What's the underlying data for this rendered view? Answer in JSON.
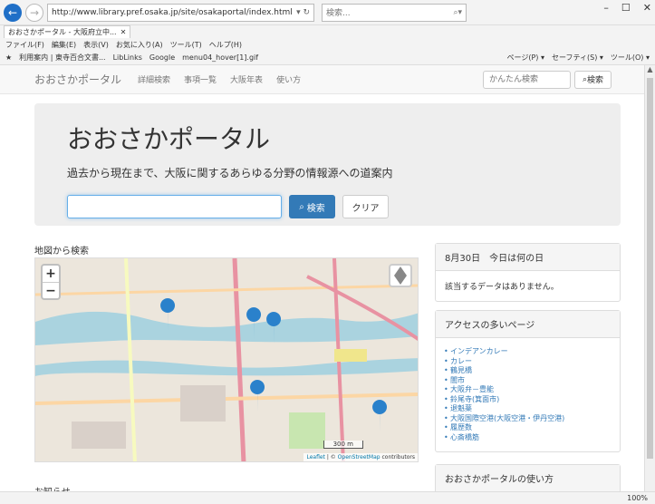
{
  "browser": {
    "url_host": "http://www.library.pref.osaka.jp",
    "url_path": "/site/osakaportal/index.html",
    "search_placeholder": "検索...",
    "tab_title": "おおさかポータル - 大阪府立中...",
    "menu": [
      "ファイル(F)",
      "編集(E)",
      "表示(V)",
      "お気に入り(A)",
      "ツール(T)",
      "ヘルプ(H)"
    ],
    "favorites": [
      "利用案内 | 東寺百合文書...",
      "LibLinks",
      "Google",
      "menu04_hover[1].gif"
    ],
    "toolbar_right": [
      "ページ(P) ▾",
      "セーフティ(S) ▾",
      "ツール(O) ▾"
    ],
    "zoom": "100%"
  },
  "site": {
    "brand": "おおさかポータル",
    "nav": [
      "詳細検索",
      "事項一覧",
      "大阪年表",
      "使い方"
    ],
    "search_placeholder": "かんたん検索",
    "search_button": "検索"
  },
  "hero": {
    "title": "おおさかポータル",
    "subtitle": "過去から現在まで、大阪に関するあらゆる分野の情報源への道案内",
    "search_button": "検索",
    "clear_button": "クリア"
  },
  "map": {
    "title": "地図から検索",
    "zoom_in": "+",
    "zoom_out": "−",
    "scale": "300 m",
    "attribution_leaflet": "Leaflet",
    "attribution_osm": "OpenStreetMap",
    "attribution_suffix": "contributors"
  },
  "today": {
    "header": "8月30日　今日は何の日",
    "body": "該当するデータはありません。"
  },
  "popular": {
    "header": "アクセスの多いページ",
    "items": [
      "インデアンカレー",
      "カレー",
      "鶴見橋",
      "闇市",
      "大阪弁－豊能",
      "鈴尾寺(箕面市)",
      "退魁薬",
      "大阪国際空港(大阪空港・伊丹空港)",
      "履歴数",
      "心斎橋筋"
    ]
  },
  "howto": {
    "header": "おおさかポータルの使い方"
  },
  "news": {
    "title": "お知らせ"
  }
}
